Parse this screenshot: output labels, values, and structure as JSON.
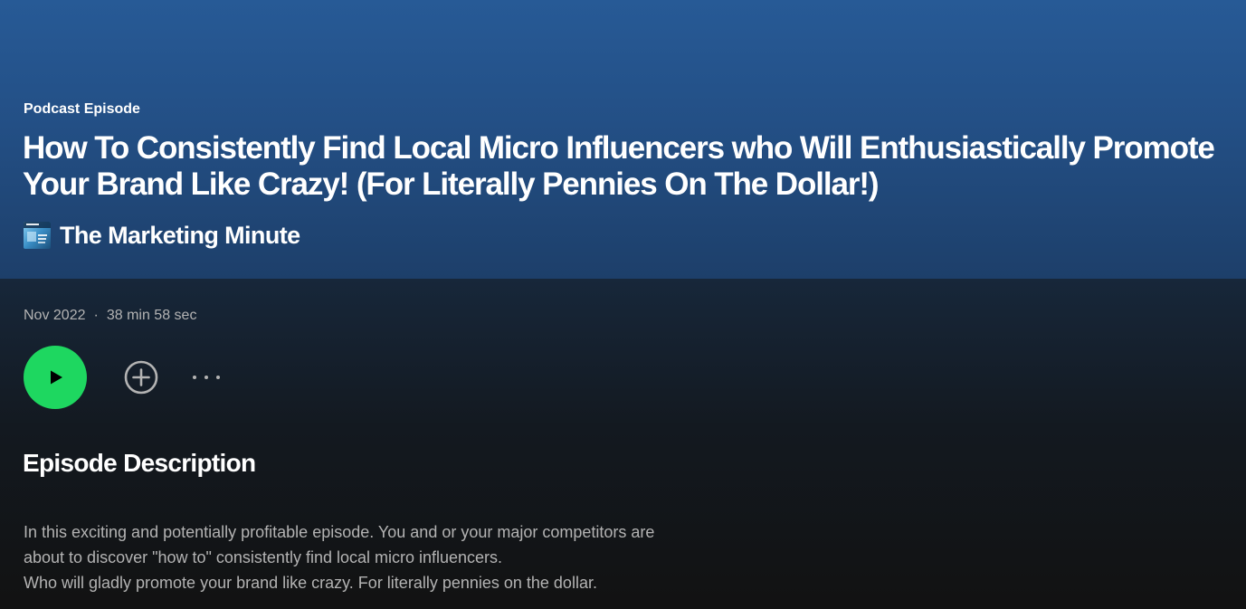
{
  "header": {
    "type_label": "Podcast Episode",
    "episode_title": "How To Consistently Find Local Micro Influencers who Will Enthusiastically Promote Your Brand Like Crazy! (For Literally Pennies On The Dollar!)",
    "show_name": "The Marketing Minute"
  },
  "meta": {
    "date": "Nov 2022",
    "separator": "·",
    "duration": "38 min 58 sec"
  },
  "actions": {
    "play_icon": "play-icon",
    "add_icon": "plus-circle-icon",
    "more_icon": "ellipsis-icon"
  },
  "description": {
    "heading": "Episode Description",
    "lines": [
      "In this exciting and potentially profitable episode. You and or your major competitors are",
      "about to discover \"how to\" consistently find local micro influencers.",
      "Who will gladly promote your brand like crazy. For literally pennies on the dollar."
    ]
  },
  "colors": {
    "hero_top": "#275a96",
    "hero_bottom": "#1d3f6a",
    "background": "#121212",
    "play_green": "#1ed760",
    "muted_text": "#b3b3b3",
    "primary_text": "#ffffff"
  }
}
